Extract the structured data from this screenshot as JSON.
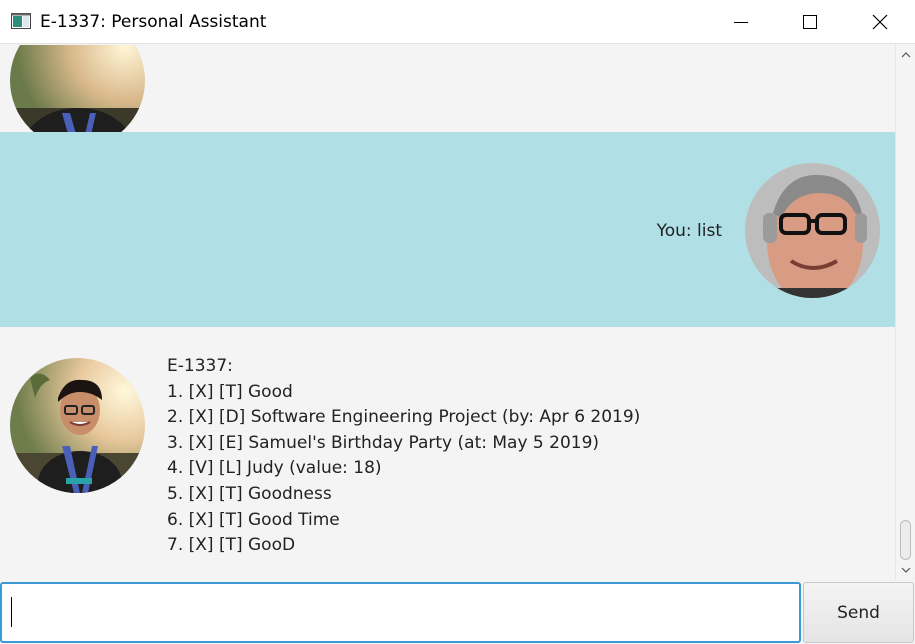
{
  "window": {
    "title": "E-1337: Personal Assistant"
  },
  "icons": {
    "app": "app-window-icon",
    "minimize": "minimize-icon",
    "maximize": "maximize-icon",
    "close": "close-icon",
    "scroll_up": "chevron-up-icon",
    "scroll_down": "chevron-down-icon"
  },
  "colors": {
    "user_bubble_bg": "#b0dfe5",
    "chat_bg": "#f4f4f4",
    "input_focus_border": "#3a9bd6"
  },
  "messages": {
    "user": {
      "text": "You: list"
    },
    "bot": {
      "header": "E-1337:",
      "lines": [
        "1. [X] [T] Good",
        "2. [X] [D] Software Engineering Project (by: Apr 6 2019)",
        "3. [X] [E] Samuel's Birthday Party (at: May 5 2019)",
        "4. [V] [L] Judy (value: 18)",
        "5. [X] [T] Goodness",
        "6. [X] [T] Good Time",
        "7. [X] [T] GooD"
      ]
    }
  },
  "input": {
    "value": "",
    "placeholder": ""
  },
  "send_button": {
    "label": "Send"
  }
}
